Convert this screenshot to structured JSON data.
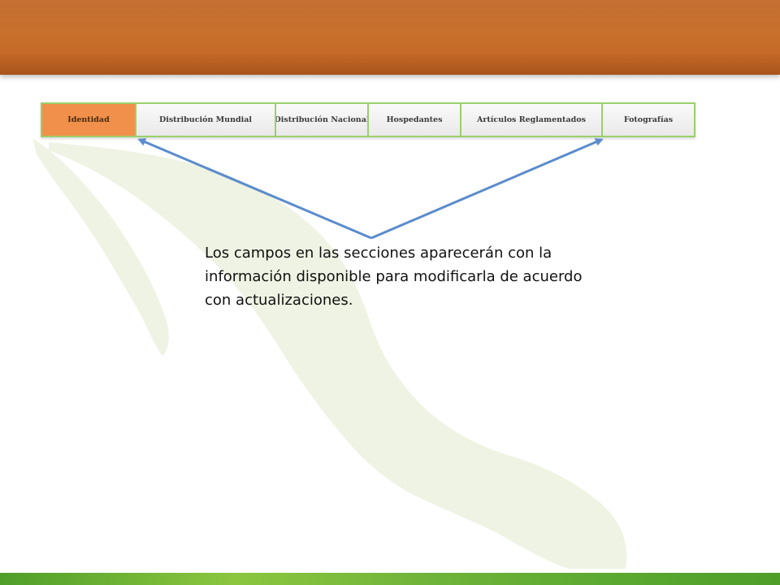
{
  "slide": {
    "tabs": [
      {
        "label": "Identidad",
        "active": true
      },
      {
        "label": "Distribución Mundial",
        "active": false
      },
      {
        "label": "Distribución Nacional",
        "active": false
      },
      {
        "label": "Hospedantes",
        "active": false
      },
      {
        "label": "Artículos Reglamentados",
        "active": false
      },
      {
        "label": "Fotografías",
        "active": false
      }
    ],
    "note": "Los campos en las secciones aparecerán con la información disponible para modificarla de acuerdo con actualizaciones."
  },
  "colors": {
    "banner": "#c56a28",
    "active_tab": "#f0904a",
    "tab_border": "#9bcf6b",
    "arrow": "#5b8ccc",
    "footer": "#6fb33a",
    "map": "#eef3e3"
  }
}
